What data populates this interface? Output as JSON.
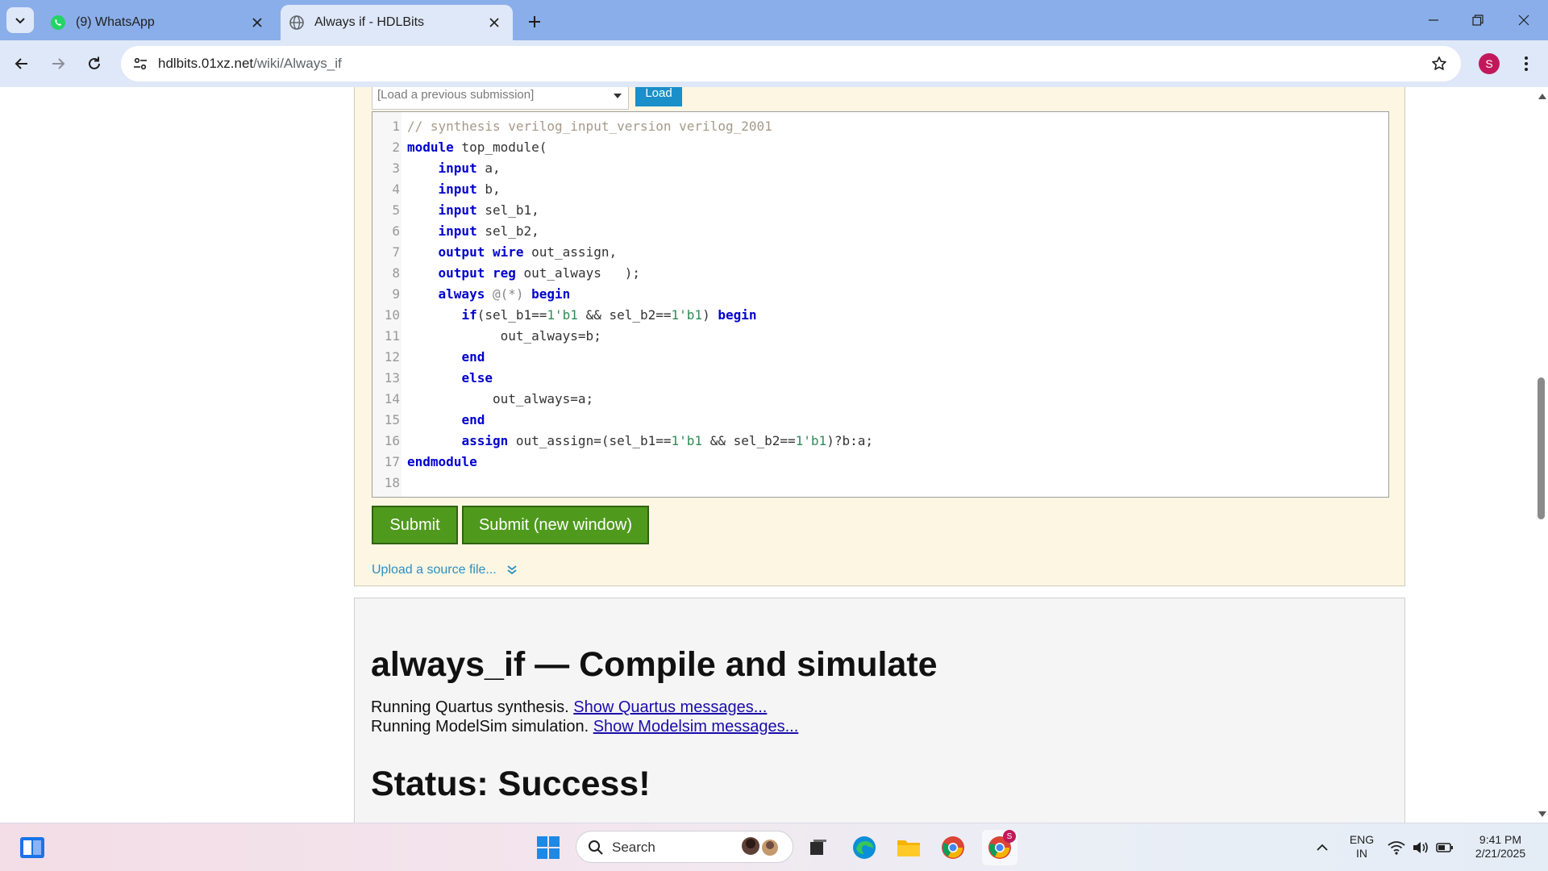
{
  "browser": {
    "tabs": [
      {
        "label": "(9) WhatsApp",
        "icon": "whatsapp-icon",
        "active": false
      },
      {
        "label": "Always if - HDLBits",
        "icon": "globe-icon",
        "active": true
      }
    ],
    "url_host": "hdlbits.01xz.net",
    "url_path": "/wiki/Always_if",
    "profile_initial": "S"
  },
  "editor": {
    "load_placeholder": "[Load a previous submission]",
    "load_button": "Load",
    "submit_label": "Submit",
    "submit_new_window_label": "Submit (new window)",
    "upload_label": "Upload a source file..."
  },
  "result": {
    "title": "always_if — Compile and simulate",
    "line1_text": "Running Quartus synthesis.",
    "line1_link": "Show Quartus messages...",
    "line2_text": "Running ModelSim simulation.",
    "line2_link": "Show Modelsim messages...",
    "status": "Status: Success!"
  },
  "taskbar": {
    "search_placeholder": "Search",
    "lang_line1": "ENG",
    "lang_line2": "IN",
    "time": "9:41 PM",
    "date": "2/21/2025",
    "chrome_badge": "S"
  },
  "colors": {
    "accent_green": "#4f9a1d",
    "link_blue": "#1a0dab",
    "keyword_blue": "#0000cc",
    "editor_background": "#fdf6e3"
  }
}
